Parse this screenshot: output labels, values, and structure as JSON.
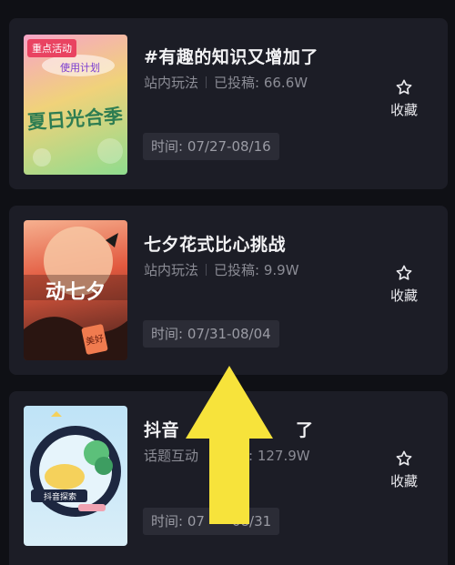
{
  "items": [
    {
      "title": "#有趣的知识又增加了",
      "type": "站内玩法",
      "submissions": "已投稿: 66.6W",
      "time": "时间: 07/27-08/16",
      "badge": "重点活动",
      "thumb_text": "夏日光合季",
      "thumb_sub": "使用计划",
      "fav_label": "收藏"
    },
    {
      "title": "七夕花式比心挑战",
      "type": "站内玩法",
      "submissions": "已投稿: 9.9W",
      "time": "时间: 07/31-08/04",
      "thumb_text": "动七夕",
      "thumb_tag": "美好",
      "fav_label": "收藏"
    },
    {
      "title": "抖音探索来了",
      "title_visible": "抖音",
      "title_visible_end": "了",
      "type": "话题互动",
      "submissions": "稿: 127.9W",
      "time_visible_start": "时间: 07",
      "time_visible_end": "08/31",
      "thumb_tag": "抖音探索",
      "fav_label": "收藏"
    }
  ],
  "colors": {
    "background": "#0f1015",
    "card": "#1c1d26",
    "title": "#f2f2f4",
    "meta": "#8b8c95",
    "chip": "#2b2c36",
    "badge": "#e94361",
    "arrow": "#f7e33b"
  },
  "icons": {
    "favorite": "star-outline-icon",
    "pointer": "up-arrow-annotation"
  }
}
